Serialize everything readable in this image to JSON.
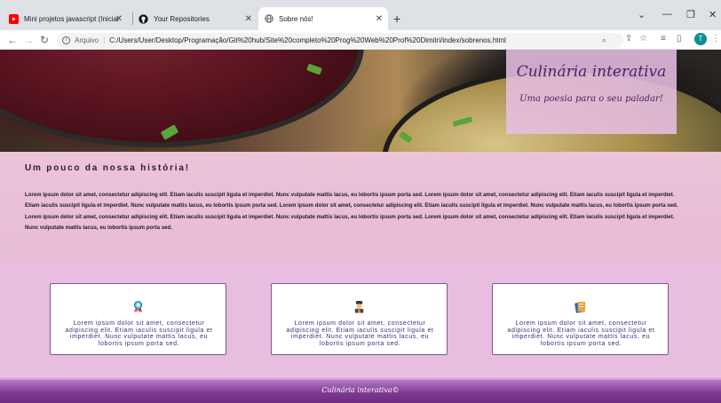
{
  "browser": {
    "tabs": [
      {
        "title": "Mini projetos javascript (Iniciante)",
        "icon": "youtube-icon"
      },
      {
        "title": "Your Repositories",
        "icon": "github-icon"
      },
      {
        "title": "Sobre nós!",
        "icon": "globe-icon"
      }
    ],
    "address": {
      "scheme_label": "Arquivo",
      "url": "C:/Users/User/Desktop/Programação/Git%20hub/Site%20completo%20Prog%20Web%20Prof%20Dimitri/index/sobrenos.html"
    },
    "profile_initial": "T",
    "colors": {
      "profile": "#0b8f8f",
      "tabbar": "#dee1e6"
    }
  },
  "header": {
    "brand": "Culinária interativa",
    "tagline": "Uma poesia para o seu paladar!"
  },
  "story": {
    "heading": "Um pouco da nossa história!",
    "body": "Lorem ipsum dolor sit amet, consectetur adipiscing elit. Etiam iaculis suscipit ligula et imperdiet. Nunc vulputate mattis lacus, eu lobortis ipsum porta sed. Lorem ipsum dolor sit amet, consectetur adipiscing elit. Etiam iaculis suscipit ligula et imperdiet. Etiam iaculis suscipit ligula et imperdiet. Nunc vulputate mattis lacus, eu lobortis ipsum porta sed. Lorem ipsum dolor sit amet, consectetur adipiscing elit. Etiam iaculis suscipit ligula et imperdiet. Nunc vulputate mattis lacus, eu lobortis ipsum porta sed. Lorem ipsum dolor sit amet, consectetur adipiscing elit. Etiam iaculis suscipit ligula et imperdiet. Nunc vulputate mattis lacus, eu lobortis ipsum porta sed. Lorem ipsum dolor sit amet, consectetur adipiscing elit. Etiam iaculis suscipit ligula et imperdiet. Nunc vulputate mattis lacus, eu lobortis ipsum porta sed."
  },
  "cards": [
    {
      "icon": "award-ribbon-icon",
      "text": "Lorem ipsum dolor sit amet, consectetur adipiscing elit. Etiam iaculis suscipit ligula et imperdiet. Nunc vulputate mattis lacus, eu lobortis ipsum porta sed."
    },
    {
      "icon": "chef-icon",
      "text": "Lorem ipsum dolor sit amet, consectetur adipiscing elit. Etiam iaculis suscipit ligula et imperdiet. Nunc vulputate mattis lacus, eu lobortis ipsum porta sed."
    },
    {
      "icon": "recipe-book-icon",
      "text": "Lorem ipsum dolor sit amet, consectetur adipiscing elit. Etiam iaculis suscipit ligula et imperdiet. Nunc vulputate mattis lacus, eu lobortis ipsum porta sed."
    }
  ],
  "footer": {
    "text": "Culinária interativa©"
  },
  "theme": {
    "accent": "#4b1f6a",
    "page_bg": "#e8bde0",
    "footer": "#7e3a92"
  }
}
